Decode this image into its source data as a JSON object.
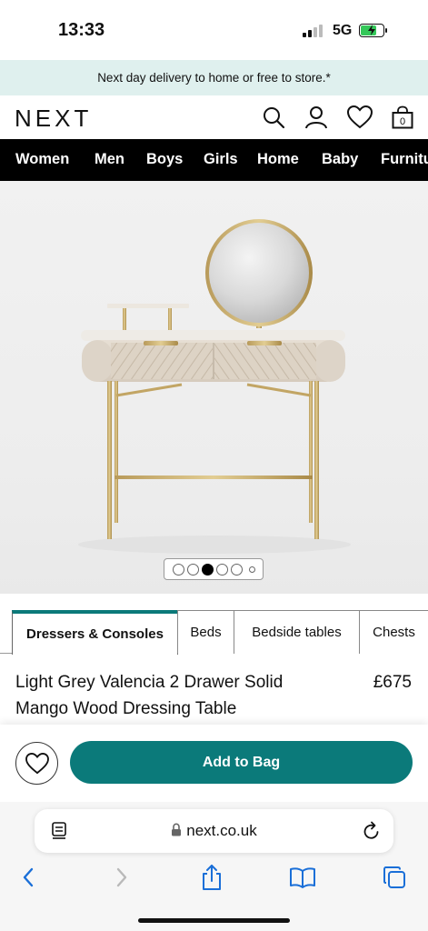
{
  "status_bar": {
    "time": "13:33",
    "network": "5G",
    "battery_level": 0.75,
    "signal_bars": 2
  },
  "banner": {
    "text": "Next day delivery to home or free to store.*"
  },
  "header": {
    "logo": "NEXT",
    "icons": [
      "search-icon",
      "account-icon",
      "heart-icon",
      "bag-icon"
    ],
    "bag_count": "0"
  },
  "nav": {
    "items": [
      "Women",
      "Men",
      "Boys",
      "Girls",
      "Home",
      "Baby",
      "Furniture"
    ]
  },
  "carousel": {
    "total_dots": 6,
    "active_index": 2
  },
  "category_tabs": [
    {
      "label": "Dressers & Consoles",
      "active": true
    },
    {
      "label": "Beds",
      "active": false
    },
    {
      "label": "Bedside tables",
      "active": false
    },
    {
      "label": "Chests",
      "active": false
    }
  ],
  "product": {
    "title": "Light Grey Valencia 2 Drawer Solid Mango Wood Dressing Table",
    "price": "£675"
  },
  "actions": {
    "add_to_bag": "Add to Bag"
  },
  "browser": {
    "url": "next.co.uk"
  },
  "colors": {
    "accent": "#0b7a7a",
    "banner_bg": "#dff0ee",
    "nav_bg": "#000000"
  }
}
